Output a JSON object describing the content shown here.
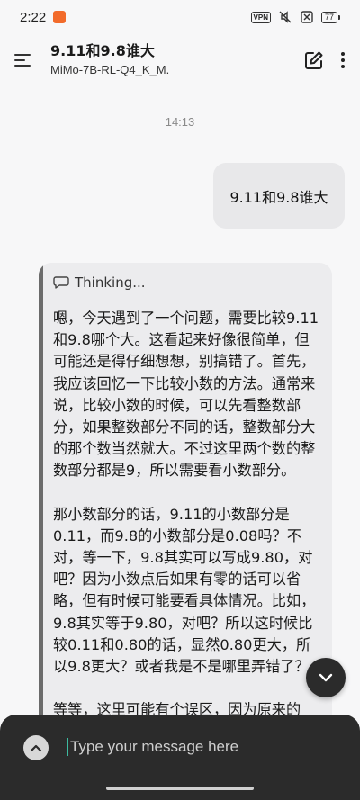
{
  "status_bar": {
    "time": "2:22",
    "vpn_label": "VPN",
    "battery_level": "77",
    "icons": [
      "screen-record-icon",
      "vpn-icon",
      "mute-icon",
      "no-sim-icon",
      "battery-icon"
    ]
  },
  "header": {
    "title": "9.11和9.8谁大",
    "model": "MiMo-7B-RL-Q4_K_M.",
    "icons": [
      "menu-icon",
      "new-chat-icon",
      "more-vert-icon"
    ]
  },
  "chat": {
    "timestamp": "14:13",
    "user_message": "9.11和9.8谁大",
    "thinking_label": "Thinking...",
    "thinking_paragraphs": [
      "嗯，今天遇到了一个问题，需要比较9.11和9.8哪个大。这看起来好像很简单，但可能还是得仔细想想，别搞错了。首先，我应该回忆一下比较小数的方法。通常来说，比较小数的时候，可以先看整数部分，如果整数部分不同的话，整数部分大的那个数当然就大。不过这里两个数的整数部分都是9，所以需要看小数部分。",
      "那小数部分的话，9.11的小数部分是0.11，而9.8的小数部分是0.08吗？不对，等一下，9.8其实可以写成9.80，对吧？因为小数点后如果有零的话可以省略，但有时候可能要看具体情况。比如，9.8其实等于9.80，对吧？所以这时候比较0.11和0.80的话，显然0.80更大，所以9.8更大？或者我是不是哪里弄错了？",
      "等等，这里可能有个误区，因为原来的"
    ]
  },
  "composer": {
    "placeholder": "Type your message here",
    "icons": [
      "expand-up-icon"
    ]
  },
  "colors": {
    "background": "#f7f7f8",
    "user_bubble": "#e8e8ea",
    "assistant_bubble": "#ececee",
    "composer": "#2b2b2b",
    "record_orange": "#f26b2b",
    "cursor_teal": "#3dbba0"
  }
}
